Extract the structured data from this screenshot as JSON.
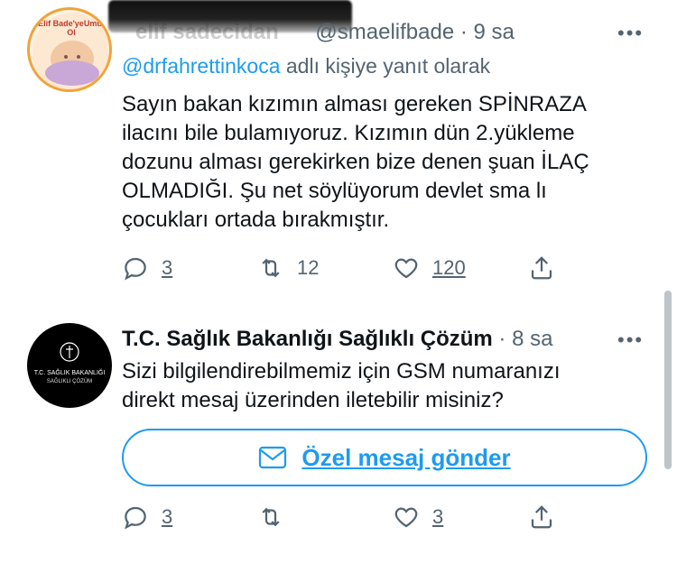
{
  "tweet1": {
    "display_name": "elif sadecidan",
    "handle": "@smaelifbade",
    "time": "9 sa",
    "reply_prefix": "@drfahrettinkoca",
    "reply_suffix": " adlı kişiye yanıt olarak",
    "text": "Sayın bakan kızımın alması gereken SPİNRAZA\nilacını bile bulamıyoruz. Kızımın dün 2.yükleme\ndozunu alması gerekirken bize denen şuan İLAÇ\nOLMADIĞI. Şu net söylüyorum devlet sma lı\nçocukları ortada bırakmıştır.",
    "avatar_text": "Elif Bade'yeUmut Ol",
    "replies": "3",
    "retweets": "12",
    "likes": "120"
  },
  "tweet2": {
    "display_name": "T.C. Sağlık Bakanlığı Sağlıklı Çözüm",
    "time": "8 sa",
    "text": "Sizi bilgilendirebilmemiz için GSM numaranızı\ndirekt mesaj üzerinden iletebilir misiniz?",
    "avatar_line1": "T.C. SAĞLIK BAKANLIĞI",
    "avatar_line2": "SAĞLIKLI ÇÖZÜM",
    "dm_label": "Özel mesaj gönder",
    "replies": "3",
    "likes": "3"
  },
  "separator": " · ",
  "more_glyph": "•••",
  "icons": [
    "reply-icon",
    "retweet-icon",
    "like-icon",
    "share-icon",
    "mail-icon",
    "more-icon"
  ],
  "colors": {
    "accent": "#1d9bf0",
    "muted": "#536471",
    "text": "#0f1419"
  }
}
